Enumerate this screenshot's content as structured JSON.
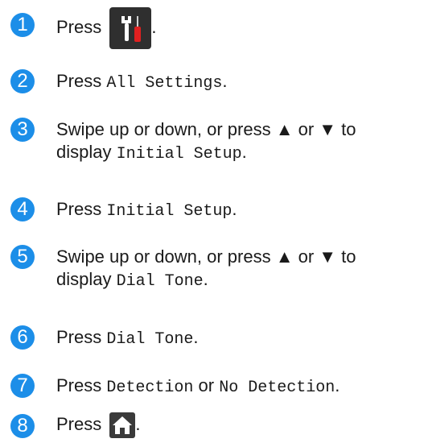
{
  "steps": [
    {
      "num": "1",
      "t1": "Press",
      "icon": "settings-tools-icon",
      "t2": "."
    },
    {
      "num": "2",
      "t1": "Press ",
      "m1": "All Settings",
      "t2": "."
    },
    {
      "num": "3",
      "t1": "Swipe up or down, or press ▲ or ▼ to",
      "t2": "display ",
      "m1": "Initial Setup",
      "t3": "."
    },
    {
      "num": "4",
      "t1": "Press ",
      "m1": "Initial Setup",
      "t2": "."
    },
    {
      "num": "5",
      "t1": "Swipe up or down, or press ▲ or ▼ to",
      "t2": "display ",
      "m1": "Dial Tone",
      "t3": "."
    },
    {
      "num": "6",
      "t1": "Press ",
      "m1": "Dial Tone",
      "t2": "."
    },
    {
      "num": "7",
      "t1": "Press ",
      "m1": "Detection",
      "t2": " or ",
      "m2": "No Detection",
      "t3": "."
    },
    {
      "num": "8",
      "t1": "Press",
      "icon": "home-icon",
      "t2": "."
    }
  ],
  "colors": {
    "badge": "#1c8ee8",
    "icon_bg": "#2f2f2f",
    "tool_red": "#e02020"
  }
}
